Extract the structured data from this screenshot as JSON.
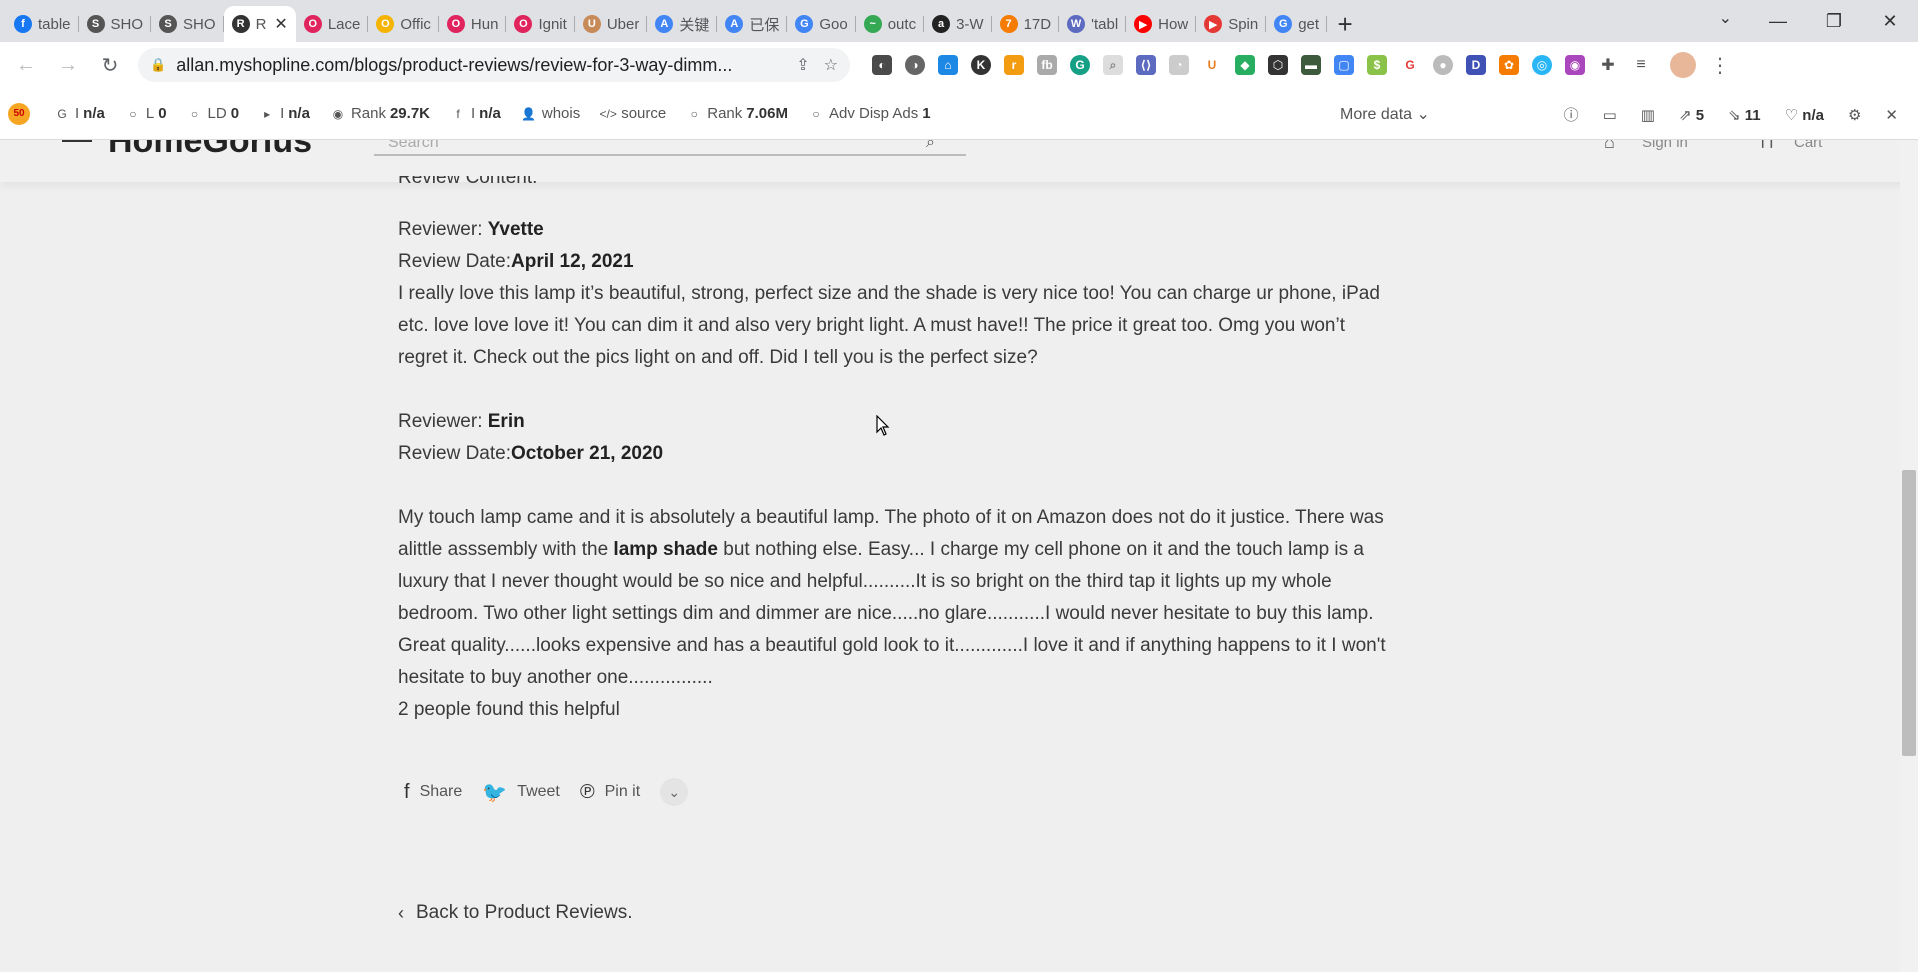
{
  "browser": {
    "tabs": [
      {
        "label": "table",
        "icon_color": "#1877f2",
        "glyph": "f"
      },
      {
        "label": "SHO",
        "icon_color": "#555555",
        "glyph": "S"
      },
      {
        "label": "SHO",
        "icon_color": "#555555",
        "glyph": "S"
      },
      {
        "label": "R",
        "icon_color": "#333333",
        "glyph": "R",
        "active": true
      },
      {
        "label": "Lace",
        "icon_color": "#e0245e",
        "glyph": "O"
      },
      {
        "label": "Offic",
        "icon_color": "#f4b400",
        "glyph": "O"
      },
      {
        "label": "Hun",
        "icon_color": "#e0245e",
        "glyph": "O"
      },
      {
        "label": "Ignit",
        "icon_color": "#e0245e",
        "glyph": "O"
      },
      {
        "label": "Uber",
        "icon_color": "#c68b59",
        "glyph": "U"
      },
      {
        "label": "关键",
        "icon_color": "#4285f4",
        "glyph": "A"
      },
      {
        "label": "已保",
        "icon_color": "#4285f4",
        "glyph": "A"
      },
      {
        "label": "Goo",
        "icon_color": "#4285f4",
        "glyph": "G"
      },
      {
        "label": "outc",
        "icon_color": "#34a853",
        "glyph": "~"
      },
      {
        "label": "3-W",
        "icon_color": "#222222",
        "glyph": "a"
      },
      {
        "label": "17D",
        "icon_color": "#f57c00",
        "glyph": "7"
      },
      {
        "label": "'tabl",
        "icon_color": "#5c6bc0",
        "glyph": "W"
      },
      {
        "label": "How",
        "icon_color": "#ff0000",
        "glyph": "▶"
      },
      {
        "label": "Spin",
        "icon_color": "#e53935",
        "glyph": "▶"
      },
      {
        "label": "get",
        "icon_color": "#4285f4",
        "glyph": "G"
      }
    ],
    "url": "allan.myshopline.com/blogs/product-reviews/review-for-3-way-dimm...",
    "window_controls": {
      "minimize": "—",
      "maximize": "❐",
      "close": "✕"
    }
  },
  "seo_toolbar": {
    "items": [
      {
        "icon": "G",
        "label": "I",
        "value": "n/a"
      },
      {
        "icon": "○",
        "label": "L",
        "value": "0"
      },
      {
        "icon": "○",
        "label": "LD",
        "value": "0"
      },
      {
        "icon": "▸",
        "label": "I",
        "value": "n/a"
      },
      {
        "icon": "◉",
        "label": "Rank",
        "value": "29.7K"
      },
      {
        "icon": "f",
        "label": "I",
        "value": "n/a"
      },
      {
        "icon": "👤",
        "label": "whois",
        "value": ""
      },
      {
        "icon": "</>",
        "label": "source",
        "value": ""
      },
      {
        "icon": "○",
        "label": "Rank",
        "value": "7.06M"
      },
      {
        "icon": "○",
        "label": "Adv Disp Ads",
        "value": "1"
      }
    ],
    "more_data": "More data",
    "right": {
      "links_out": "5",
      "links_in": "11",
      "health": "n/a"
    }
  },
  "site_header": {
    "logo": "HomeGorius",
    "search_placeholder": "Search",
    "account_label": "Sign in",
    "cart_label": "Cart"
  },
  "review_header_partial": "Review Content:",
  "reviews": [
    {
      "reviewer_label": "Reviewer: ",
      "reviewer": "Yvette",
      "date_label": "Review Date:",
      "date": "April 12, 2021",
      "lines": [
        "I really love this lamp it’s beautiful, strong, perfect size and the shade is very nice too! You can charge ur phone, iPad",
        "etc. love love love it! You can dim it and also very bright light. A must have!! The price it great too. Omg you won’t",
        "regret it. Check out the pics light on and off. Did I tell you is the perfect size?"
      ]
    },
    {
      "reviewer_label": "Reviewer: ",
      "reviewer": "Erin",
      "date_label": "Review Date:",
      "date": "October 21, 2020",
      "line1": "My touch lamp came and it is absolutely a beautiful lamp. The photo of it on Amazon does not do it justice. There was",
      "line2_before": "alittle asssembly with the ",
      "line2_bold": "lamp shade",
      "line2_after": " but nothing else. Easy... I charge my cell phone on it and the touch lamp is a",
      "lines_rest": [
        "luxury that I never thought would be so nice and helpful..........It is so bright on the third tap it lights up my whole",
        "bedroom. Two other light settings dim and dimmer are nice.....no glare...........I would never hesitate to buy this lamp.",
        "Great quality......looks expensive and has a beautiful gold look to it.............I love it and if anything happens to it I won't",
        "hesitate to buy another one................"
      ],
      "helpful": "2 people found this helpful"
    }
  ],
  "share": {
    "share": "Share",
    "tweet": "Tweet",
    "pin": "Pin it"
  },
  "back_link": "Back to Product Reviews."
}
